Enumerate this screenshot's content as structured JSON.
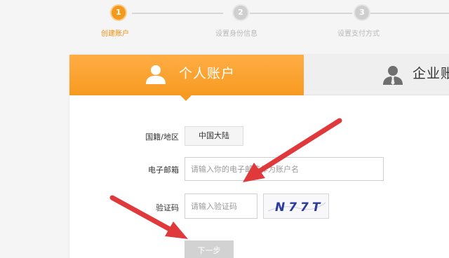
{
  "steps": [
    {
      "number": "1",
      "label": "创建账户"
    },
    {
      "number": "2",
      "label": "设置身份信息"
    },
    {
      "number": "3",
      "label": "设置支付方式"
    }
  ],
  "tabs": {
    "personal": {
      "label": "个人账户",
      "icon": "user-icon"
    },
    "business": {
      "label": "企业账",
      "icon": "business-user-icon"
    }
  },
  "form": {
    "region": {
      "label": "国籍/地区",
      "value": "中国大陆"
    },
    "email": {
      "label": "电子邮箱",
      "placeholder": "请输入你的电子邮箱作为账户名"
    },
    "captcha": {
      "label": "验证码",
      "placeholder": "请输入验证码",
      "image_text": "N77T"
    },
    "next_button": "下一步"
  },
  "colors": {
    "accent": "#f79a20",
    "annotation_arrow": "#e0393c",
    "disabled_button": "#d2d2d2"
  }
}
